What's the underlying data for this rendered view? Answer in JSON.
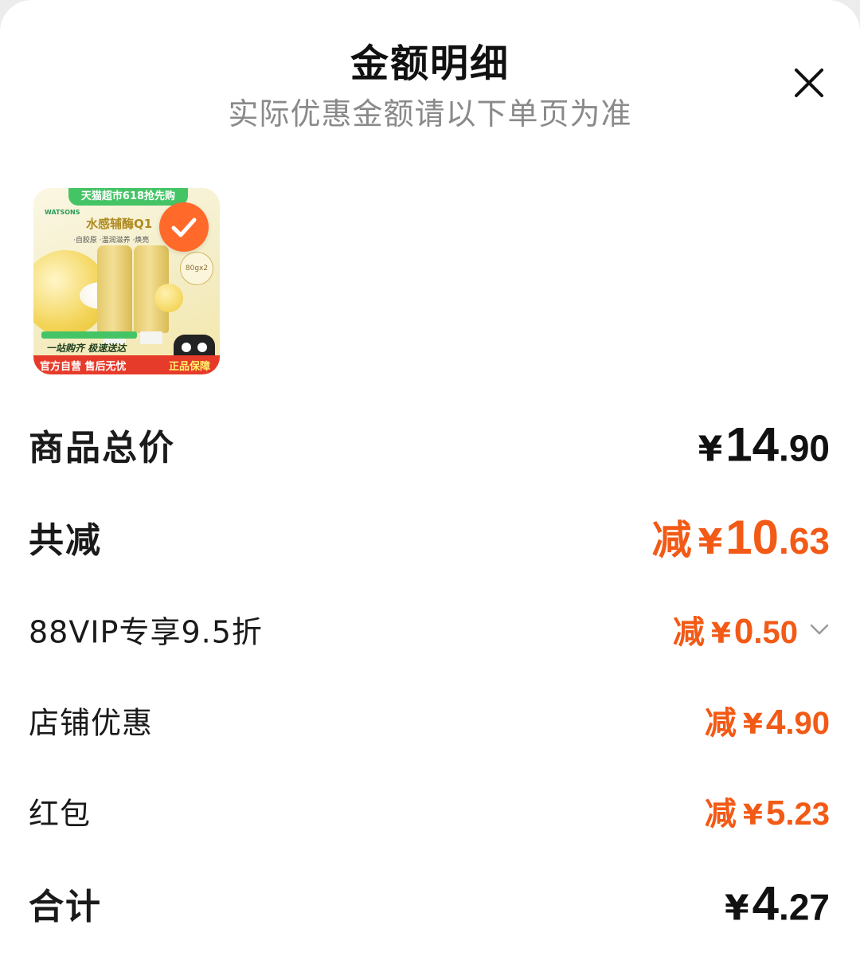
{
  "header": {
    "title": "金额明细",
    "subtitle": "实际优惠金额请以下单页为准"
  },
  "product": {
    "banner_text": "天猫超市618抢先购",
    "brand": "WATSONS",
    "name": "水感辅酶Q1",
    "features": "·自胶原 ·温润滋养 ·焕亮",
    "size": "80gx2",
    "slogan": "一站购齐 极速送达",
    "bottom_left": "官方自营 售后无忧",
    "bottom_right": "正品保障",
    "selected": true
  },
  "rows": {
    "subtotal": {
      "label": "商品总价",
      "currency": "¥",
      "int": "14",
      "dec": ".90"
    },
    "total_discount": {
      "label": "共减",
      "prefix": "减",
      "currency": "¥",
      "int": "10",
      "dec": ".63"
    },
    "vip": {
      "label": "88VIP专享9.5折",
      "prefix": "减",
      "currency": "¥",
      "int": "0",
      "dec": ".50"
    },
    "shop": {
      "label": "店铺优惠",
      "prefix": "减",
      "currency": "¥",
      "int": "4",
      "dec": ".90"
    },
    "redpacket": {
      "label": "红包",
      "prefix": "减",
      "currency": "¥",
      "int": "5",
      "dec": ".23"
    },
    "total": {
      "label": "合计",
      "currency": "¥",
      "int": "4",
      "dec": ".27"
    }
  },
  "icons": {
    "close": "close-icon",
    "check": "check-icon",
    "chevron": "chevron-down-icon"
  },
  "colors": {
    "accent": "#f25a16",
    "text": "#1a1a1a",
    "subtitle": "#8a8a8a",
    "check_badge": "#ff6a2a"
  }
}
